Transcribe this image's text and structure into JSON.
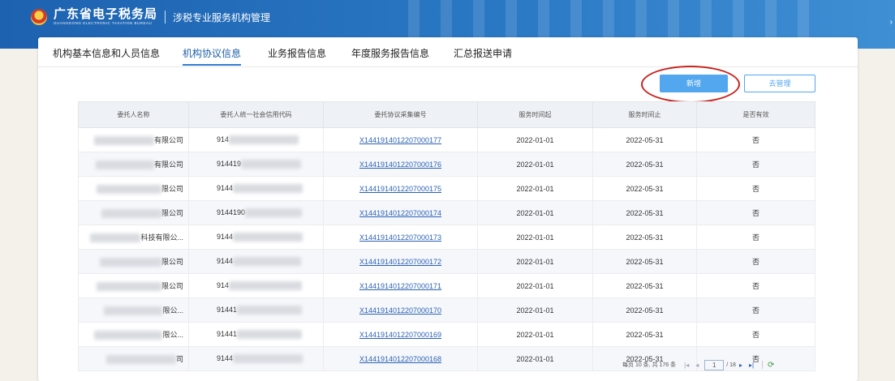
{
  "header": {
    "brand_cn": "广东省电子税务局",
    "brand_en": "GUANGDONG ELECTRONIC TAXATION BUREAU",
    "module_title": "涉税专业服务机构管理"
  },
  "tabs": [
    {
      "label": "机构基本信息和人员信息",
      "active": false
    },
    {
      "label": "机构协议信息",
      "active": true
    },
    {
      "label": "业务报告信息",
      "active": false
    },
    {
      "label": "年度服务报告信息",
      "active": false
    },
    {
      "label": "汇总报送申请",
      "active": false
    }
  ],
  "toolbar": {
    "add_label": "新增",
    "manage_label": "去管理"
  },
  "table": {
    "columns": [
      "委托人名称",
      "委托人统一社会信用代码",
      "委托协议采集编号",
      "服务时间起",
      "服务时间止",
      "是否有效"
    ],
    "rows": [
      {
        "name": "有限公司",
        "credit": "914",
        "protocol_no": "X1441914012207000177",
        "start": "2022-01-01",
        "end": "2022-05-31",
        "valid": "否"
      },
      {
        "name": "有限公司",
        "credit": "914419",
        "protocol_no": "X1441914012207000176",
        "start": "2022-01-01",
        "end": "2022-05-31",
        "valid": "否"
      },
      {
        "name": "限公司",
        "credit": "9144",
        "protocol_no": "X1441914012207000175",
        "start": "2022-01-01",
        "end": "2022-05-31",
        "valid": "否"
      },
      {
        "name": "限公司",
        "credit": "9144190",
        "protocol_no": "X1441914012207000174",
        "start": "2022-01-01",
        "end": "2022-05-31",
        "valid": "否"
      },
      {
        "name": "科技有限公...",
        "credit": "9144",
        "protocol_no": "X1441914012207000173",
        "start": "2022-01-01",
        "end": "2022-05-31",
        "valid": "否"
      },
      {
        "name": "限公司",
        "credit": "9144",
        "protocol_no": "X1441914012207000172",
        "start": "2022-01-01",
        "end": "2022-05-31",
        "valid": "否"
      },
      {
        "name": "限公司",
        "credit": "914",
        "protocol_no": "X1441914012207000171",
        "start": "2022-01-01",
        "end": "2022-05-31",
        "valid": "否"
      },
      {
        "name": "限公...",
        "credit": "91441",
        "protocol_no": "X1441914012207000170",
        "start": "2022-01-01",
        "end": "2022-05-31",
        "valid": "否"
      },
      {
        "name": "限公...",
        "credit": "91441",
        "protocol_no": "X1441914012207000169",
        "start": "2022-01-01",
        "end": "2022-05-31",
        "valid": "否"
      },
      {
        "name": "司",
        "credit": "9144",
        "protocol_no": "X1441914012207000168",
        "start": "2022-01-01",
        "end": "2022-05-31",
        "valid": "否"
      }
    ]
  },
  "pagination": {
    "summary": "每页 10 条, 共 176 条",
    "current_page": "1",
    "total_pages": "/ 18"
  },
  "colors": {
    "header_blue": "#2a78c4",
    "accent": "#52a7ee",
    "link": "#2c62b4",
    "highlight_ring": "#c9211b"
  },
  "icons": [
    "emblem-icon",
    "first-page-icon",
    "prev-page-icon",
    "next-page-icon",
    "last-page-icon",
    "refresh-icon",
    "chevron-right-icon"
  ]
}
